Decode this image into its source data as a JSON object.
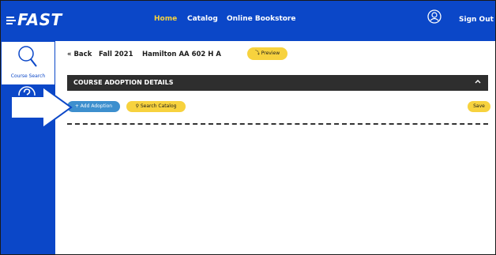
{
  "brand": {
    "logo_text": "FAST"
  },
  "topnav": {
    "links": [
      {
        "label": "Home",
        "active": true
      },
      {
        "label": "Catalog"
      },
      {
        "label": "Online Bookstore"
      }
    ],
    "sign_out_label": "Sign Out",
    "user_icon": "user-circle-icon"
  },
  "sidebar": {
    "items": [
      {
        "label": "Course Search",
        "icon": "search-icon",
        "active": true
      },
      {
        "label": "",
        "icon": "help-icon"
      }
    ]
  },
  "breadcrumb": {
    "back_label": "« Back",
    "term": "Fall 2021",
    "course": "Hamilton AA 602 H A",
    "preview_label": "⤵ Preview"
  },
  "details": {
    "title": "COURSE ADOPTION DETAILS",
    "collapse_icon": "chevron-up-icon"
  },
  "actions": {
    "add_adoption_label": "+ Add Adoption",
    "search_catalog_label": "Search Catalog",
    "save_label": "Save"
  },
  "colors": {
    "brand_blue": "#0b47c8",
    "accent_yellow": "#f7d23e",
    "button_blue": "#3d8fce",
    "bar_dark": "#2e2e2e"
  }
}
